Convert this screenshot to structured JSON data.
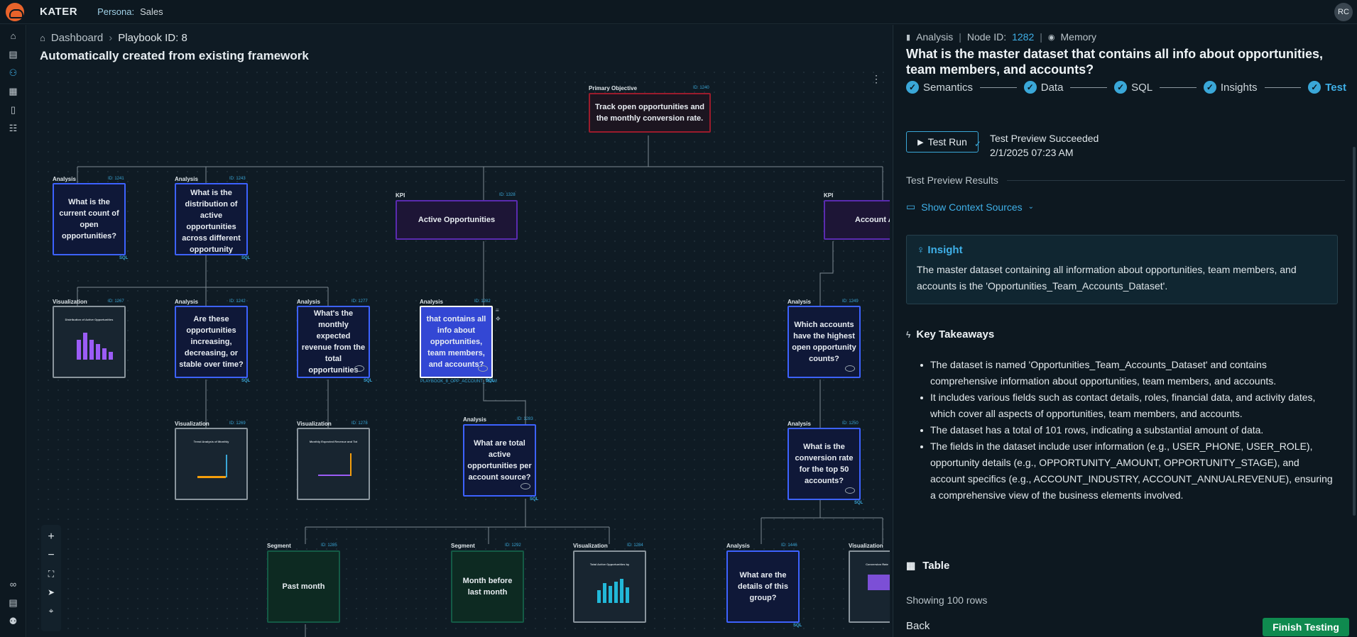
{
  "app": {
    "brand": "KATER",
    "persona_label": "Persona:",
    "persona_value": "Sales",
    "avatar": "RC"
  },
  "sidebar": {
    "items": [
      "home-icon",
      "document-icon",
      "flow-icon",
      "map-icon",
      "book-icon",
      "users-icon"
    ],
    "bottom": [
      "link-icon",
      "file-icon",
      "user-settings-icon"
    ]
  },
  "breadcrumb": {
    "home": "Dashboard",
    "current": "Playbook ID: 8"
  },
  "page_title": "Automatically created from existing framework",
  "nodes": {
    "obj": {
      "type": "Primary Objective",
      "id": "ID: 1240",
      "text": "Track open opportunities and the monthly conversion rate."
    },
    "n1241": {
      "type": "Analysis",
      "id": "ID: 1241",
      "text": "What is the current count of open opportunities?"
    },
    "n1243": {
      "type": "Analysis",
      "id": "ID: 1243",
      "text": "What is the distribution of active opportunities across different opportunity"
    },
    "n1328": {
      "type": "KPI",
      "id": "ID: 1328",
      "text": "Active Opportunities"
    },
    "nacc": {
      "type": "KPI",
      "text": "Account A"
    },
    "n1267": {
      "type": "Visualization",
      "id": "ID: 1267",
      "text": "Distribution of Active Opportunities"
    },
    "n1242": {
      "type": "Analysis",
      "id": "ID: 1242",
      "text": "Are these opportunities increasing, decreasing, or stable over time?"
    },
    "n1277": {
      "type": "Analysis",
      "id": "ID: 1277",
      "text": "What's the monthly expected revenue from the total opportunities"
    },
    "n1282": {
      "type": "Analysis",
      "id": "ID: 1282",
      "text": "that contains all info about opportunities, team members, and accounts?",
      "tag": "PLAYBOOK_8_OPP_ACCOUNT_TEAM"
    },
    "n1249": {
      "type": "Analysis",
      "id": "ID: 1249",
      "text": "Which accounts have the highest open opportunity counts?"
    },
    "n1269": {
      "type": "Visualization",
      "id": "ID: 1269",
      "text": "Trend Analysis of Monthly"
    },
    "n1278": {
      "type": "Visualization",
      "id": "ID: 1278",
      "text": "Monthly Expected Revenue and Tot"
    },
    "n1283": {
      "type": "Analysis",
      "id": "ID: 1283",
      "text": "What are total active opportunities per account source?"
    },
    "n1250": {
      "type": "Analysis",
      "id": "ID: 1250",
      "text": "What is the conversion rate for the top 50 accounts?"
    },
    "n1285": {
      "type": "Segment",
      "id": "ID: 1285",
      "text": "Past month"
    },
    "n1292": {
      "type": "Segment",
      "id": "ID: 1292",
      "text": "Month before last month"
    },
    "n1284": {
      "type": "Visualization",
      "id": "ID: 1284",
      "text": "Total Active Opportunities by"
    },
    "n1446": {
      "type": "Analysis",
      "id": "ID: 1446",
      "text": "What are the details of this group?"
    },
    "nconv": {
      "type": "Visualization",
      "text": "Conversion Rate"
    }
  },
  "sql_label": "SQL",
  "panel": {
    "header": {
      "tab": "Analysis",
      "node_label": "Node ID:",
      "node_id": "1282",
      "memory": "Memory"
    },
    "question": "What is the master dataset that contains all info about opportunities, team members, and accounts?",
    "steps": [
      "Semantics",
      "Data",
      "SQL",
      "Insights",
      "Test"
    ],
    "run_label": "Test Run",
    "status": "Test Preview Succeeded",
    "timestamp": "2/1/2025 07:23 AM",
    "results_label": "Test Preview Results",
    "context_label": "Show Context Sources",
    "insight_title": "Insight",
    "insight_text": "The master dataset containing all information about opportunities, team members, and accounts is the 'Opportunities_Team_Accounts_Dataset'.",
    "takeaways_title": "Key Takeaways",
    "takeaways": [
      "The dataset is named 'Opportunities_Team_Accounts_Dataset' and contains comprehensive information about opportunities, team members, and accounts.",
      "It includes various fields such as contact details, roles, financial data, and activity dates, which cover all aspects of opportunities, team members, and accounts.",
      "The dataset has a total of 101 rows, indicating a substantial amount of data.",
      "The fields in the dataset include user information (e.g., USER_PHONE, USER_ROLE), opportunity details (e.g., OPPORTUNITY_AMOUNT, OPPORTUNITY_STAGE), and account specifics (e.g., ACCOUNT_INDUSTRY, ACCOUNT_ANNUALREVENUE), ensuring a comprehensive view of the business elements involved."
    ],
    "table_title": "Table",
    "rows_label": "Showing 100 rows",
    "back": "Back",
    "finish": "Finish Testing"
  },
  "colors": {
    "accent": "#3fb0e8",
    "analysis": "#3d62ff",
    "kpi": "#5a2bb0",
    "objective": "#9b1c2c",
    "segment": "#145a45",
    "finish": "#0f8a4f"
  }
}
